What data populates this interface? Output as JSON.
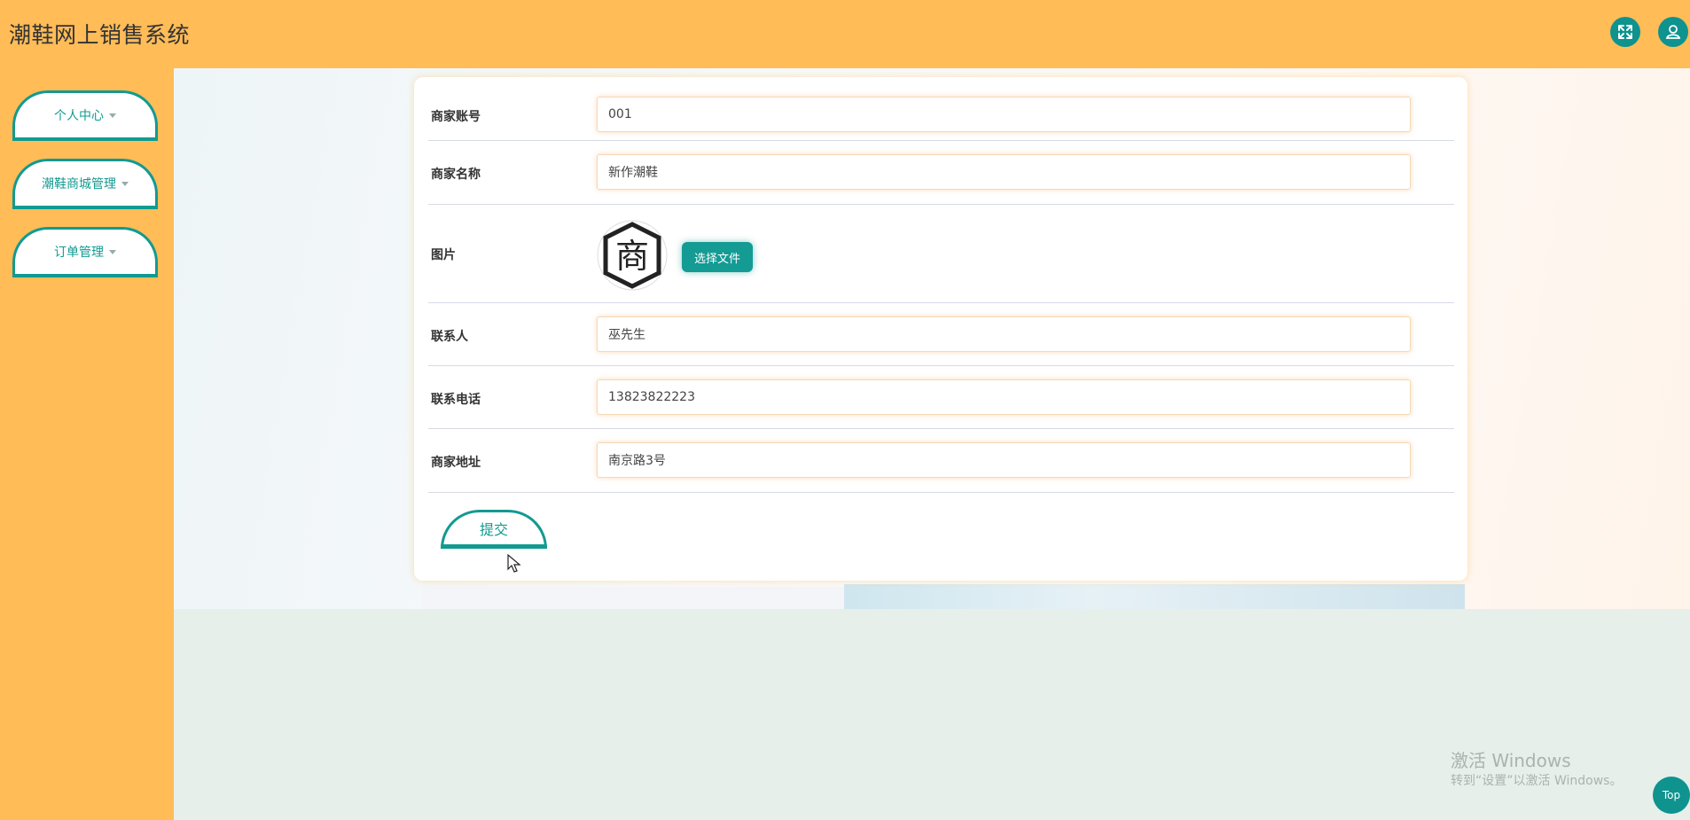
{
  "app": {
    "title": "潮鞋网上销售系统"
  },
  "header": {
    "fullscreen_icon": "expand-icon",
    "user_icon": "user-icon"
  },
  "sidebar": {
    "items": [
      {
        "label": "个人中心"
      },
      {
        "label": "潮鞋商城管理"
      },
      {
        "label": "订单管理"
      }
    ]
  },
  "form": {
    "account": {
      "label": "商家账号",
      "value": "001"
    },
    "name": {
      "label": "商家名称",
      "value": "新作潮鞋"
    },
    "image": {
      "label": "图片",
      "avatar_char": "商",
      "choose_label": "选择文件"
    },
    "contact": {
      "label": "联系人",
      "value": "巫先生"
    },
    "phone": {
      "label": "联系电话",
      "value": "13823822223"
    },
    "address": {
      "label": "商家地址",
      "value": "南京路3号"
    },
    "submit_label": "提交"
  },
  "watermark": {
    "line1": "激活 Windows",
    "line2": "转到“设置”以激活 Windows。"
  },
  "top_button": {
    "label": "Top"
  },
  "colors": {
    "accent": "#129a91",
    "header": "#ffbc57"
  }
}
